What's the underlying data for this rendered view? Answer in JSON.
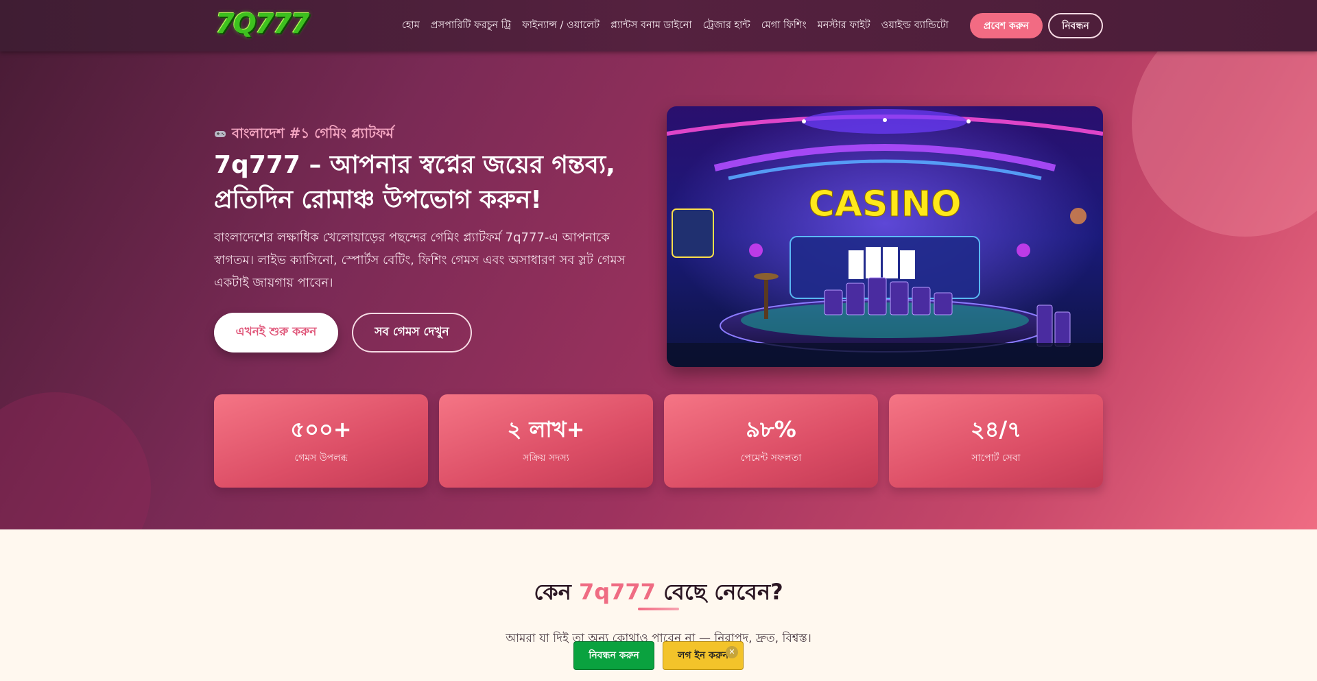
{
  "header": {
    "logo_text": "7Q777",
    "nav": [
      "হোম",
      "প্রসপারিটি ফরচুন ট্রি",
      "ফাইন্যান্স / ওয়ালেট",
      "প্ল্যান্টস বনাম ডাইনো",
      "ট্রেজার হান্ট",
      "মেগা ফিশিং",
      "মনস্টার ফাইট",
      "ওয়াইল্ড ব্যান্ডিটো"
    ],
    "login_label": "প্রবেশ করুন",
    "register_label": "নিবন্ধন"
  },
  "hero": {
    "badge_icon": "gamepad-icon",
    "badge_text": "বাংলাদেশ #১ গেমিং প্ল্যাটফর্ম",
    "title": "7q777 – আপনার স্বপ্নের জয়ের গন্তব্য, প্রতিদিন রোমাঞ্চ উপভোগ করুন!",
    "description": "বাংলাদেশের লক্ষাধিক খেলোয়াড়ের পছন্দের গেমিং প্ল্যাটফর্ম 7q777-এ আপনাকে স্বাগতম। লাইভ ক্যাসিনো, স্পোর্টস বেটিং, ফিশিং গেমস এবং অসাধারণ সব স্লট গেমস একটাই জায়গায় পাবেন।",
    "cta_primary": "এখনই শুরু করুন",
    "cta_secondary": "সব গেমস দেখুন",
    "image_sign": "CASINO"
  },
  "stats": [
    {
      "value": "৫০০+",
      "label": "গেমস উপলব্ধ"
    },
    {
      "value": "২ লাখ+",
      "label": "সক্রিয় সদস্য"
    },
    {
      "value": "৯৮%",
      "label": "পেমেন্ট সফলতা"
    },
    {
      "value": "২৪/৭",
      "label": "সাপোর্ট সেবা"
    }
  ],
  "why": {
    "title_before": "কেন ",
    "title_accent": "7q777",
    "title_after": " বেছে নেবেন?",
    "subtitle": "আমরা যা দিই তা অন্য কোথাও পাবেন না — নিরাপদ, দ্রুত, বিশ্বস্ত।"
  },
  "floating_bar": {
    "register_label": "নিবন্ধন করুন",
    "login_label": "লগ ইন করুন",
    "close_icon": "close-icon"
  },
  "colors": {
    "accent": "#ef6c83",
    "header_bg": "#4a1d38",
    "float_register": "#0aa23f",
    "float_login": "#f3c32a"
  }
}
